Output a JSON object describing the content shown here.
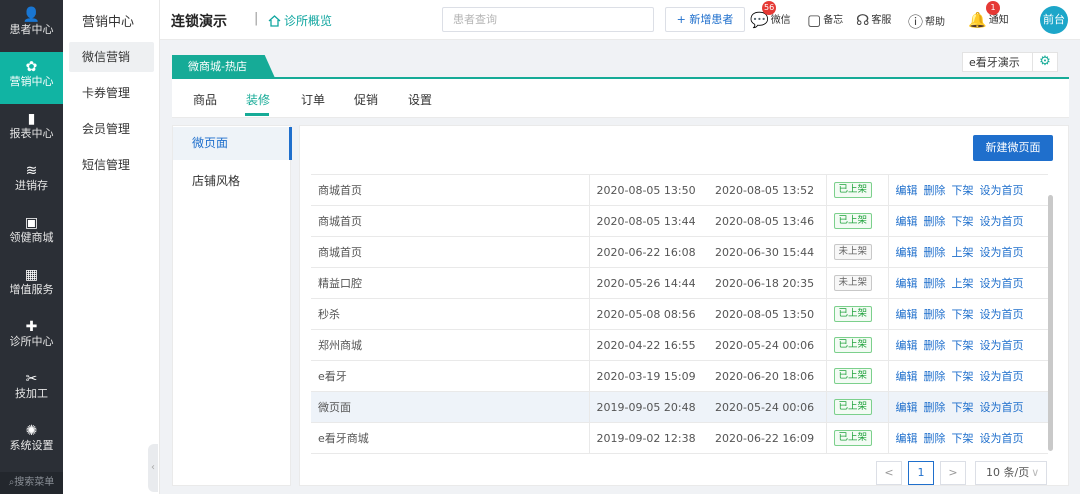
{
  "rail": {
    "items": [
      {
        "label": "患者中心",
        "icon": "person-icon",
        "glyph": "👤"
      },
      {
        "label": "营销中心",
        "icon": "flower-icon",
        "glyph": "✿"
      },
      {
        "label": "报表中心",
        "icon": "bar-chart-icon",
        "glyph": "▮"
      },
      {
        "label": "进销存",
        "icon": "layers-icon",
        "glyph": "≋"
      },
      {
        "label": "领健商城",
        "icon": "bag-icon",
        "glyph": "▣"
      },
      {
        "label": "增值服务",
        "icon": "grid-icon",
        "glyph": "▦"
      },
      {
        "label": "诊所中心",
        "icon": "clinic-icon",
        "glyph": "✚"
      },
      {
        "label": "技加工",
        "icon": "tools-icon",
        "glyph": "✂"
      },
      {
        "label": "系统设置",
        "icon": "gear-icon",
        "glyph": "✺"
      }
    ],
    "search_label": "搜索菜单",
    "search_glyph": "⌕"
  },
  "subnav": {
    "title": "营销中心",
    "items": [
      "微信营销",
      "卡券管理",
      "会员管理",
      "短信管理"
    ]
  },
  "header": {
    "brand": "连锁演示",
    "separator": "|",
    "overview": "诊所概览",
    "search_placeholder": "患者查询",
    "new_patient": "+ 新增患者",
    "wechat": "微信",
    "wechat_badge": "56",
    "memo": "备忘",
    "service": "客服",
    "help": "帮助",
    "notify": "通知",
    "notify_badge": "1",
    "front_desk": "前台",
    "wechat_glyph": "💬",
    "memo_glyph": "▢",
    "service_glyph": "☊",
    "help_glyph": "ⓘ",
    "notify_glyph": "🔔"
  },
  "module": {
    "tab": "微商城-热店",
    "store": "e看牙演示",
    "gear_glyph": "⚙",
    "tabs": [
      "商品",
      "装修",
      "订单",
      "促销",
      "设置"
    ],
    "active_tab": "装修"
  },
  "left_panel": {
    "items": [
      "微页面",
      "店铺风格"
    ]
  },
  "main": {
    "new_page_button": "新建微页面",
    "rows": [
      {
        "name": "商城首页",
        "created": "2020-08-05 13:50",
        "updated": "2020-08-05 13:52",
        "status": "已上架",
        "toggle": "下架"
      },
      {
        "name": "商城首页",
        "created": "2020-08-05 13:44",
        "updated": "2020-08-05 13:46",
        "status": "已上架",
        "toggle": "下架"
      },
      {
        "name": "商城首页",
        "created": "2020-06-22 16:08",
        "updated": "2020-06-30 15:44",
        "status": "未上架",
        "toggle": "上架"
      },
      {
        "name": "精益口腔",
        "created": "2020-05-26 14:44",
        "updated": "2020-06-18 20:35",
        "status": "未上架",
        "toggle": "上架"
      },
      {
        "name": "秒杀",
        "created": "2020-05-08 08:56",
        "updated": "2020-08-05 13:50",
        "status": "已上架",
        "toggle": "下架"
      },
      {
        "name": "郑州商城",
        "created": "2020-04-22 16:55",
        "updated": "2020-05-24 00:06",
        "status": "已上架",
        "toggle": "下架"
      },
      {
        "name": "e看牙",
        "created": "2020-03-19 15:09",
        "updated": "2020-06-20 18:06",
        "status": "已上架",
        "toggle": "下架"
      },
      {
        "name": "微页面",
        "created": "2019-09-05 20:48",
        "updated": "2020-05-24 00:06",
        "status": "已上架",
        "toggle": "下架"
      },
      {
        "name": "e看牙商城",
        "created": "2019-09-02 12:38",
        "updated": "2020-06-22 16:09",
        "status": "已上架",
        "toggle": "下架"
      }
    ],
    "actions": {
      "edit": "编辑",
      "delete": "删除",
      "set_home": "设为首页"
    }
  },
  "pager": {
    "prev": "<",
    "current": "1",
    "next": ">",
    "page_size": "10 条/页",
    "page_size_chevron": "∨"
  },
  "colors": {
    "accent": "#16ab97",
    "primary": "#1f6fcc",
    "rail_bg": "#2b2f36"
  }
}
